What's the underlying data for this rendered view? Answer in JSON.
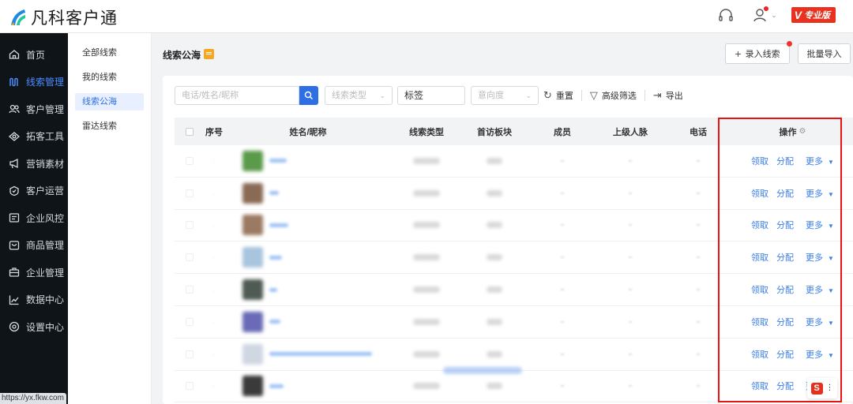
{
  "app": {
    "name": "凡科客户通",
    "vip_label": "专业版",
    "vip_mark": "V"
  },
  "header": {
    "icons": [
      "headphone-icon",
      "user-icon"
    ]
  },
  "sidebar": {
    "items": [
      {
        "label": "首页",
        "icon": "home-icon"
      },
      {
        "label": "线索管理",
        "icon": "leads-icon",
        "active": true
      },
      {
        "label": "客户管理",
        "icon": "customers-icon"
      },
      {
        "label": "拓客工具",
        "icon": "tools-icon"
      },
      {
        "label": "营销素材",
        "icon": "megaphone-icon"
      },
      {
        "label": "客户运营",
        "icon": "operation-icon"
      },
      {
        "label": "企业风控",
        "icon": "risk-icon"
      },
      {
        "label": "商品管理",
        "icon": "goods-icon"
      },
      {
        "label": "企业管理",
        "icon": "briefcase-icon"
      },
      {
        "label": "数据中心",
        "icon": "chart-icon"
      },
      {
        "label": "设置中心",
        "icon": "settings-icon"
      }
    ],
    "status_url": "https://yx.fkw.com"
  },
  "submenu": {
    "items": [
      {
        "label": "全部线索"
      },
      {
        "label": "我的线索"
      },
      {
        "label": "线索公海",
        "active": true
      },
      {
        "label": "雷达线索"
      }
    ]
  },
  "page": {
    "title": "线索公海",
    "add_button": "录入线索",
    "import_button": "批量导入"
  },
  "filters": {
    "search_placeholder": "电话/姓名/昵称",
    "type_placeholder": "线索类型",
    "tag_value": "标签",
    "intent_placeholder": "意向度",
    "reset": "重置",
    "advanced": "高级筛选",
    "export": "导出"
  },
  "table": {
    "headers": {
      "index": "序号",
      "name": "姓名/昵称",
      "type": "线索类型",
      "first_visit": "首访板块",
      "member": "成员",
      "superior": "上级人脉",
      "phone": "电话",
      "ops": "操作"
    },
    "actions": {
      "claim": "领取",
      "assign": "分配",
      "more": "更多"
    },
    "rows": [
      {
        "avatar_color": "#5a9a4a"
      },
      {
        "avatar_color": "#8a6a55"
      },
      {
        "avatar_color": "#9b7a62"
      },
      {
        "avatar_color": "#a8c4de"
      },
      {
        "avatar_color": "#4e5a52"
      },
      {
        "avatar_color": "#6a6ab8"
      },
      {
        "avatar_color": "#cfd7e2"
      },
      {
        "avatar_color": "#3a3a3a"
      }
    ]
  }
}
